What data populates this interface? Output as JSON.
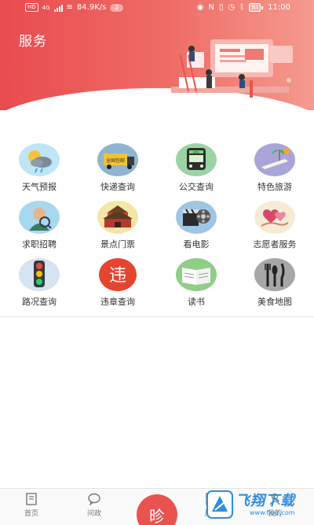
{
  "status_bar": {
    "hd": "HD",
    "network": "4G",
    "speed": "84.9K/s",
    "notif_count": "2",
    "battery": "92",
    "time": "11:00"
  },
  "header": {
    "title": "服务"
  },
  "services": [
    {
      "label": "天气预报",
      "icon": "weather-icon"
    },
    {
      "label": "快递查询",
      "icon": "delivery-truck-icon"
    },
    {
      "label": "公交查询",
      "icon": "bus-icon"
    },
    {
      "label": "特色旅游",
      "icon": "travel-icon"
    },
    {
      "label": "求职招聘",
      "icon": "job-icon"
    },
    {
      "label": "景点门票",
      "icon": "gate-icon"
    },
    {
      "label": "看电影",
      "icon": "movie-icon"
    },
    {
      "label": "志愿者服务",
      "icon": "volunteer-icon"
    },
    {
      "label": "路况查询",
      "icon": "traffic-light-icon"
    },
    {
      "label": "违章查询",
      "icon": "violation-icon"
    },
    {
      "label": "读书",
      "icon": "book-icon"
    },
    {
      "label": "美食地图",
      "icon": "food-map-icon"
    }
  ],
  "truck_text": "全国包邮",
  "bus_text": "BUS",
  "violation_char": "违",
  "tabbar": {
    "home": "首页",
    "politics": "问政",
    "center_char": "昣",
    "service": "服务",
    "mine": "我的"
  },
  "watermark": {
    "text": "飞翔下载",
    "url": "www.fxxz.com"
  },
  "colors": {
    "brand": "#e94b4f",
    "accent_blue": "#2e8de0"
  }
}
